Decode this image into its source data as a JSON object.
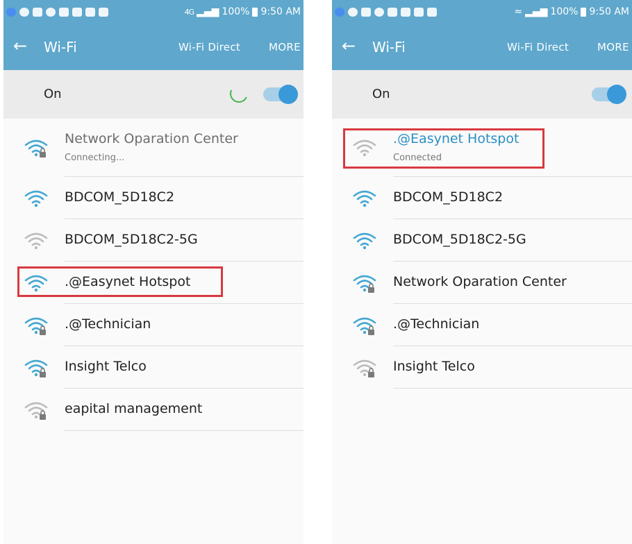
{
  "colors": {
    "header": "#5fa7cc",
    "accent": "#3a9ad9",
    "highlight": "#d8383f",
    "connected_text": "#2a8fc4"
  },
  "left": {
    "status": {
      "network": "4G",
      "battery": "100%",
      "time": "9:50 AM"
    },
    "title": "Wi-Fi",
    "actions": {
      "wifi_direct": "Wi-Fi Direct",
      "more": "MORE"
    },
    "toggle_label": "On",
    "networks": [
      {
        "name": "Network Oparation Center",
        "sub": "Connecting...",
        "locked": true,
        "strength": "blue"
      },
      {
        "name": "BDCOM_5D18C2",
        "locked": false,
        "strength": "blue"
      },
      {
        "name": "BDCOM_5D18C2-5G",
        "locked": false,
        "strength": "grey"
      },
      {
        "name": ".@Easynet Hotspot",
        "locked": false,
        "strength": "blue",
        "highlighted": true
      },
      {
        "name": ".@Technician",
        "locked": true,
        "strength": "blue"
      },
      {
        "name": "Insight Telco",
        "locked": true,
        "strength": "blue"
      },
      {
        "name": "eapital management",
        "locked": true,
        "strength": "grey"
      }
    ]
  },
  "right": {
    "status": {
      "battery": "100%",
      "time": "9:50 AM"
    },
    "title": "Wi-Fi",
    "actions": {
      "wifi_direct": "Wi-Fi Direct",
      "more": "MORE"
    },
    "toggle_label": "On",
    "networks": [
      {
        "name": ".@Easynet Hotspot",
        "sub": "Connected",
        "locked": false,
        "strength": "grey",
        "highlighted": true
      },
      {
        "name": "BDCOM_5D18C2",
        "locked": false,
        "strength": "blue"
      },
      {
        "name": "BDCOM_5D18C2-5G",
        "locked": false,
        "strength": "blue"
      },
      {
        "name": "Network Oparation Center",
        "locked": true,
        "strength": "blue"
      },
      {
        "name": ".@Technician",
        "locked": true,
        "strength": "blue"
      },
      {
        "name": "Insight Telco",
        "locked": true,
        "strength": "grey"
      }
    ]
  }
}
